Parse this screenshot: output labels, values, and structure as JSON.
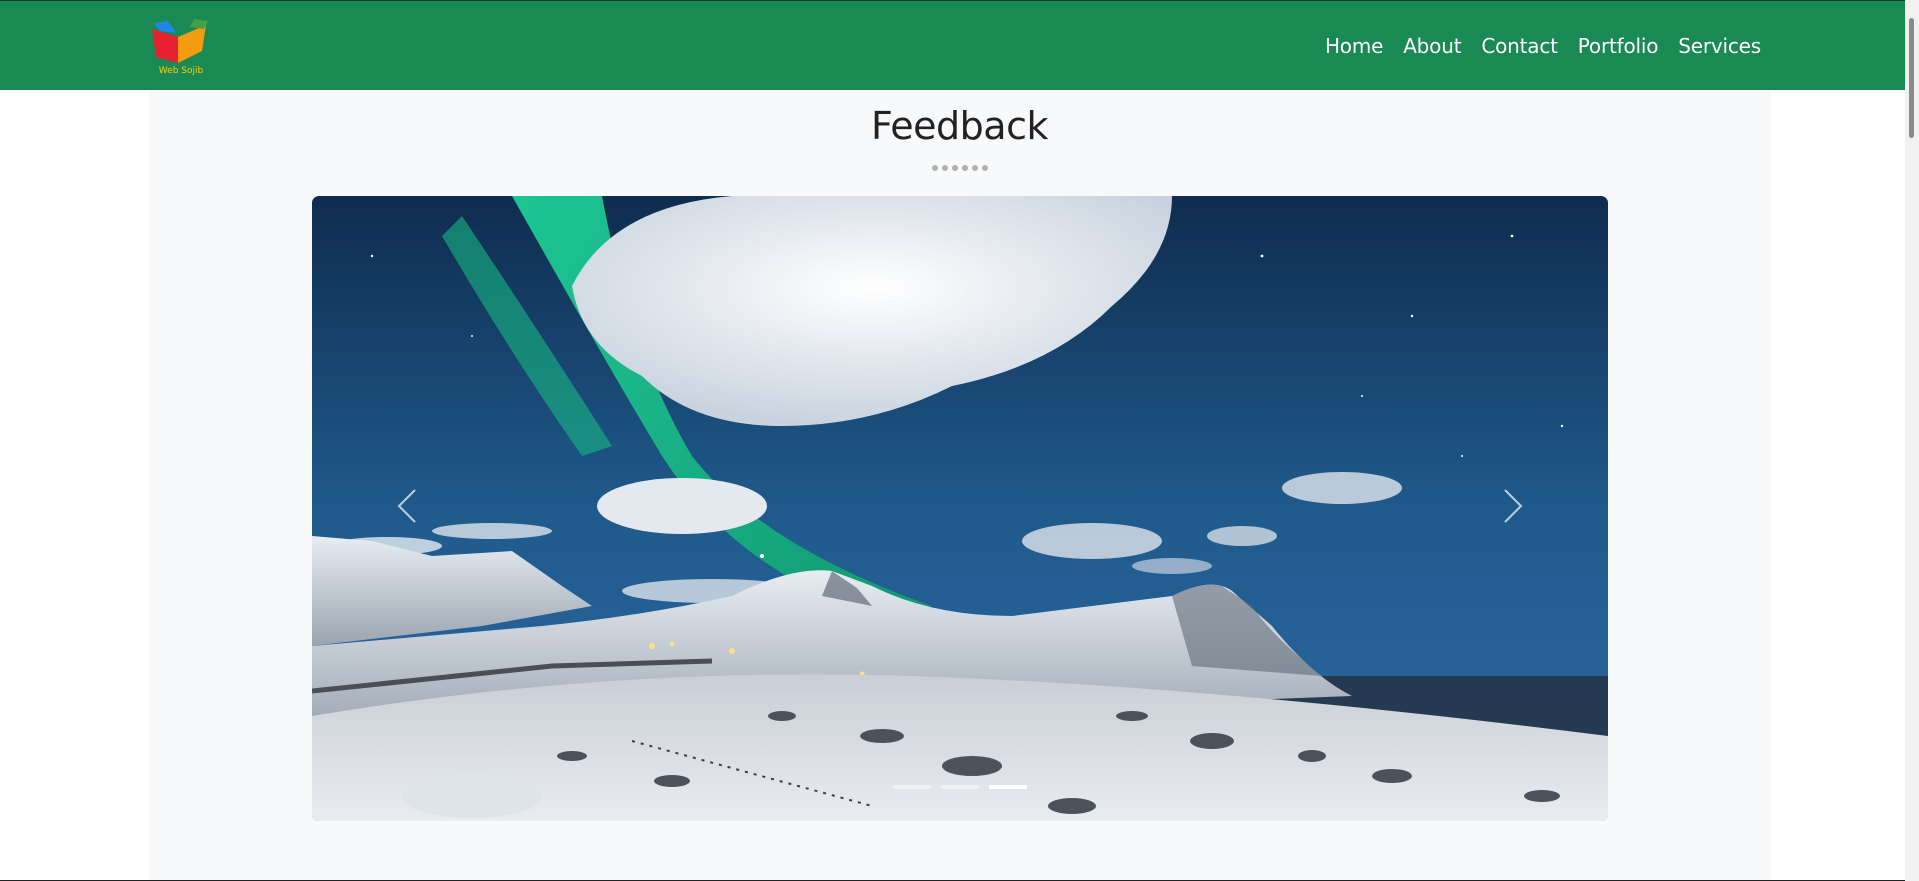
{
  "brand": {
    "logo_text": "Web Sojib",
    "logo_colors": [
      "#e8212e",
      "#f39c12",
      "#1e88e5",
      "#43a047"
    ]
  },
  "nav": {
    "links": [
      "Home",
      "About",
      "Contact",
      "Portfolio",
      "Services"
    ],
    "background": "#1a8a55"
  },
  "section": {
    "title": "Feedback",
    "dot_count": 6
  },
  "carousel": {
    "slide_image": "aurora over snowy mountains and rocky beach at night",
    "indicator_count": 3,
    "active_indicator": 3,
    "prev_icon": "chevron-left-icon",
    "next_icon": "chevron-right-icon"
  }
}
